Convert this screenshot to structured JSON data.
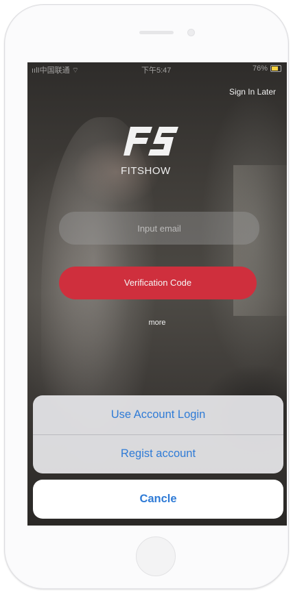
{
  "status_bar": {
    "left": "ıılI中国联通 ⌔",
    "time": "下午5:47",
    "battery": "76%"
  },
  "header": {
    "sign_in_later": "Sign In Later"
  },
  "brand": {
    "logo_mark": "FS",
    "name": "FITSHOW"
  },
  "login_form": {
    "email_placeholder": "Input email",
    "verification_button": "Verification Code",
    "more_label": "more"
  },
  "action_sheet": {
    "options": [
      "Use Account Login",
      "Regist account"
    ],
    "cancel_label": "Cancle"
  },
  "colors": {
    "accent_red": "#cf2f3d",
    "ios_blue": "#2f7bd6"
  }
}
